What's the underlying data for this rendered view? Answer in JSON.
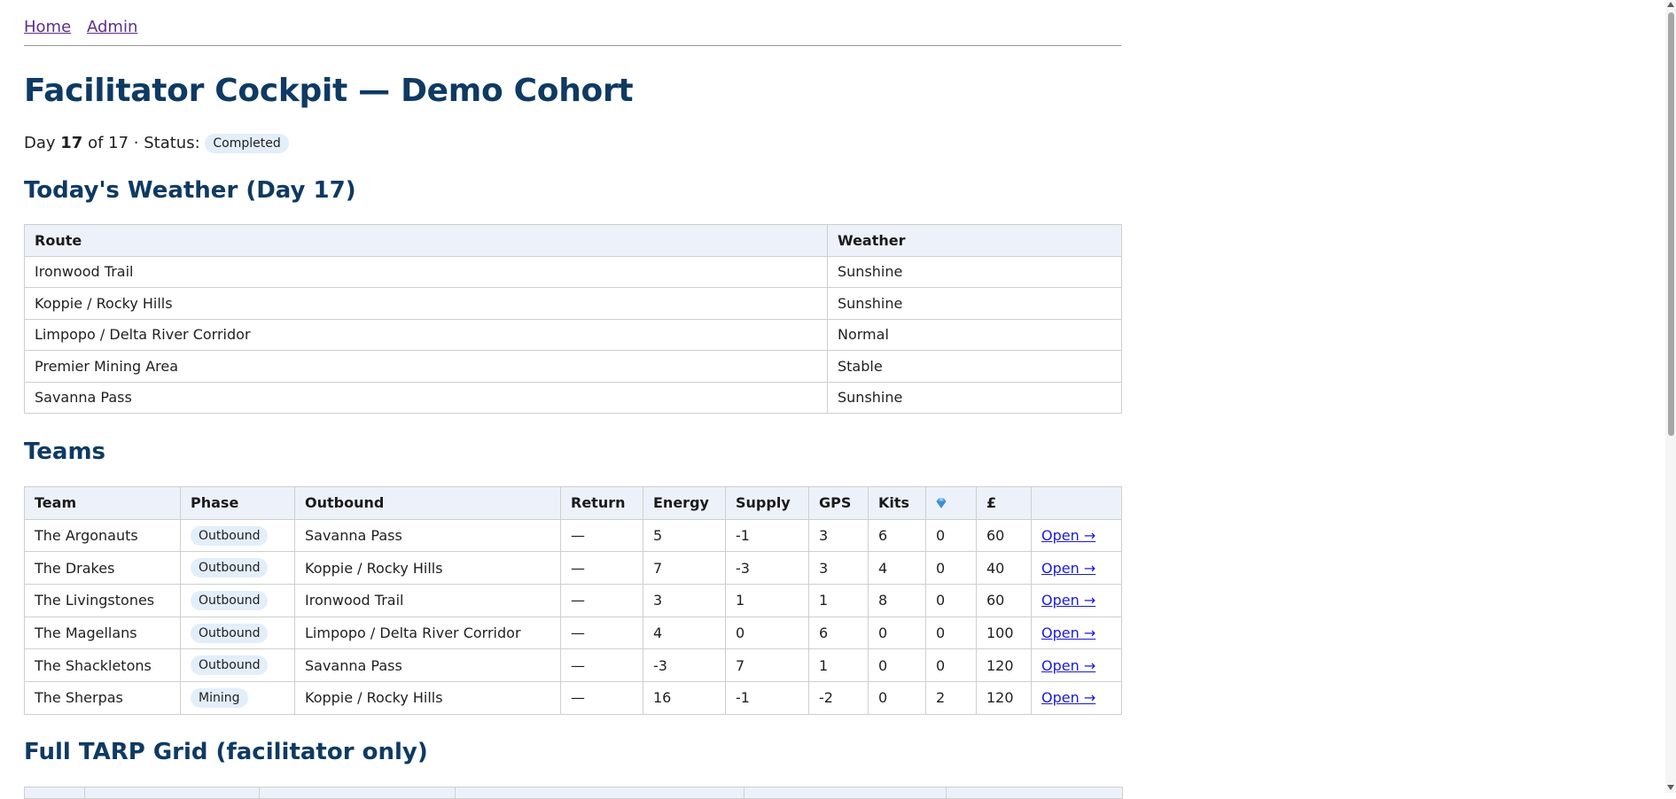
{
  "nav": {
    "home": "Home",
    "admin": "Admin"
  },
  "page": {
    "title": "Facilitator Cockpit — Demo Cohort",
    "day_prefix": "Day",
    "day_current": "17",
    "day_mid": "of 17 · Status:",
    "status": "Completed"
  },
  "weather": {
    "heading": "Today's Weather (Day 17)",
    "columns": [
      "Route",
      "Weather"
    ],
    "rows": [
      [
        "Ironwood Trail",
        "Sunshine"
      ],
      [
        "Koppie / Rocky Hills",
        "Sunshine"
      ],
      [
        "Limpopo / Delta River Corridor",
        "Normal"
      ],
      [
        "Premier Mining Area",
        "Stable"
      ],
      [
        "Savanna Pass",
        "Sunshine"
      ]
    ]
  },
  "teams": {
    "heading": "Teams",
    "columns": [
      "Team",
      "Phase",
      "Outbound",
      "Return",
      "Energy",
      "Supply",
      "GPS",
      "Kits",
      "",
      "£",
      ""
    ],
    "gem_icon": "gem-icon",
    "rows": [
      {
        "team": "The Argonauts",
        "phase": "Outbound",
        "outbound": "Savanna Pass",
        "return": "—",
        "energy": "5",
        "supply": "-1",
        "gps": "3",
        "kits": "6",
        "gems": "0",
        "pounds": "60",
        "link": "Open →"
      },
      {
        "team": "The Drakes",
        "phase": "Outbound",
        "outbound": "Koppie / Rocky Hills",
        "return": "—",
        "energy": "7",
        "supply": "-3",
        "gps": "3",
        "kits": "4",
        "gems": "0",
        "pounds": "40",
        "link": "Open →"
      },
      {
        "team": "The Livingstones",
        "phase": "Outbound",
        "outbound": "Ironwood Trail",
        "return": "—",
        "energy": "3",
        "supply": "1",
        "gps": "1",
        "kits": "8",
        "gems": "0",
        "pounds": "60",
        "link": "Open →"
      },
      {
        "team": "The Magellans",
        "phase": "Outbound",
        "outbound": "Limpopo / Delta River Corridor",
        "return": "—",
        "energy": "4",
        "supply": "0",
        "gps": "6",
        "kits": "0",
        "gems": "0",
        "pounds": "100",
        "link": "Open →"
      },
      {
        "team": "The Shackletons",
        "phase": "Outbound",
        "outbound": "Savanna Pass",
        "return": "—",
        "energy": "-3",
        "supply": "7",
        "gps": "1",
        "kits": "0",
        "gems": "0",
        "pounds": "120",
        "link": "Open →"
      },
      {
        "team": "The Sherpas",
        "phase": "Mining",
        "outbound": "Koppie / Rocky Hills",
        "return": "—",
        "energy": "16",
        "supply": "-1",
        "gps": "-2",
        "kits": "0",
        "gems": "2",
        "pounds": "120",
        "link": "Open →"
      }
    ]
  },
  "tarp": {
    "heading": "Full TARP Grid (facilitator only)"
  },
  "colors": {
    "heading": "#0e3a63",
    "badge_bg": "#e3eefb",
    "table_header_bg": "#edf2fa",
    "link": "#1a1adb",
    "visited_link": "#5b2f8f"
  }
}
